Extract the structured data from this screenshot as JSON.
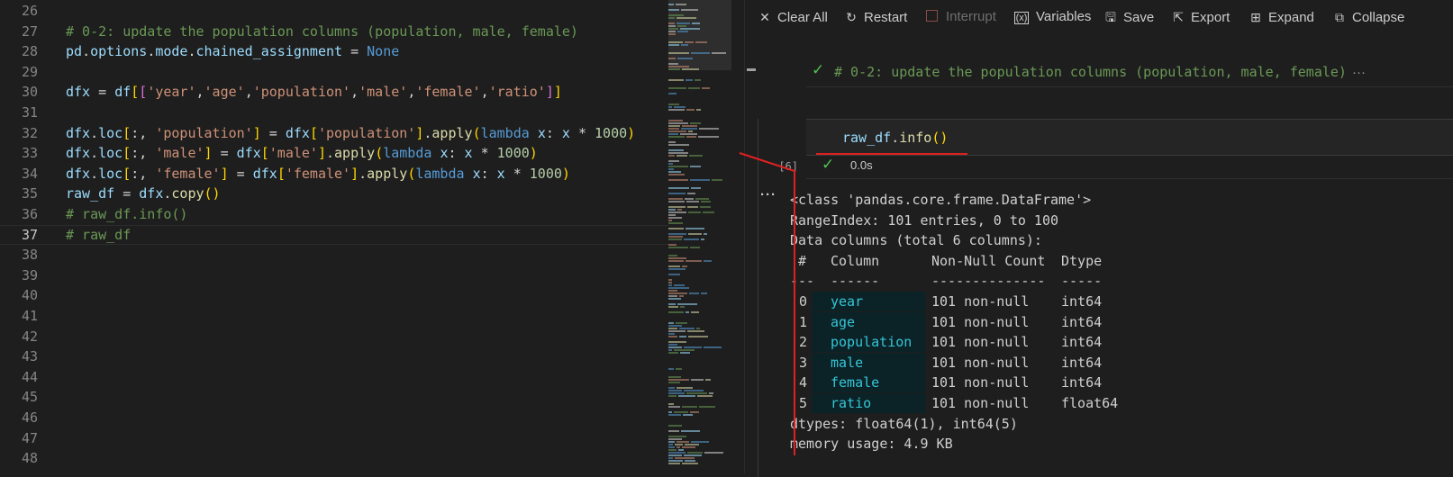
{
  "editor": {
    "lines": [
      {
        "num": "26",
        "tokens": []
      },
      {
        "num": "27",
        "tokens": [
          [
            "cm",
            "# 0-2: update the population columns (population, male, female)"
          ]
        ]
      },
      {
        "num": "28",
        "tokens": [
          [
            "vr",
            "pd"
          ],
          [
            "op",
            "."
          ],
          [
            "vr",
            "options"
          ],
          [
            "op",
            "."
          ],
          [
            "vr",
            "mode"
          ],
          [
            "op",
            "."
          ],
          [
            "vr",
            "chained_assignment"
          ],
          [
            "op",
            " = "
          ],
          [
            "kw",
            "None"
          ]
        ]
      },
      {
        "num": "29",
        "tokens": []
      },
      {
        "num": "30",
        "tokens": [
          [
            "vr",
            "dfx"
          ],
          [
            "op",
            " = "
          ],
          [
            "vr",
            "df"
          ],
          [
            "b1",
            "["
          ],
          [
            "b2",
            "["
          ],
          [
            "st",
            "'year'"
          ],
          [
            "op",
            ","
          ],
          [
            "st",
            "'age'"
          ],
          [
            "op",
            ","
          ],
          [
            "st",
            "'population'"
          ],
          [
            "op",
            ","
          ],
          [
            "st",
            "'male'"
          ],
          [
            "op",
            ","
          ],
          [
            "st",
            "'female'"
          ],
          [
            "op",
            ","
          ],
          [
            "st",
            "'ratio'"
          ],
          [
            "b2",
            "]"
          ],
          [
            "b1",
            "]"
          ]
        ]
      },
      {
        "num": "31",
        "tokens": []
      },
      {
        "num": "32",
        "tokens": [
          [
            "vr",
            "dfx"
          ],
          [
            "op",
            "."
          ],
          [
            "vr",
            "loc"
          ],
          [
            "b1",
            "["
          ],
          [
            "op",
            ":, "
          ],
          [
            "st",
            "'population'"
          ],
          [
            "b1",
            "]"
          ],
          [
            "op",
            " = "
          ],
          [
            "vr",
            "dfx"
          ],
          [
            "b1",
            "["
          ],
          [
            "st",
            "'population'"
          ],
          [
            "b1",
            "]"
          ],
          [
            "op",
            "."
          ],
          [
            "fn",
            "apply"
          ],
          [
            "b1",
            "("
          ],
          [
            "kw",
            "lambda"
          ],
          [
            "op",
            " "
          ],
          [
            "vr",
            "x"
          ],
          [
            "op",
            ": "
          ],
          [
            "vr",
            "x"
          ],
          [
            "op",
            " * "
          ],
          [
            "nm",
            "1000"
          ],
          [
            "b1",
            ")"
          ]
        ]
      },
      {
        "num": "33",
        "tokens": [
          [
            "vr",
            "dfx"
          ],
          [
            "op",
            "."
          ],
          [
            "vr",
            "loc"
          ],
          [
            "b1",
            "["
          ],
          [
            "op",
            ":, "
          ],
          [
            "st",
            "'male'"
          ],
          [
            "b1",
            "]"
          ],
          [
            "op",
            " = "
          ],
          [
            "vr",
            "dfx"
          ],
          [
            "b1",
            "["
          ],
          [
            "st",
            "'male'"
          ],
          [
            "b1",
            "]"
          ],
          [
            "op",
            "."
          ],
          [
            "fn",
            "apply"
          ],
          [
            "b1",
            "("
          ],
          [
            "kw",
            "lambda"
          ],
          [
            "op",
            " "
          ],
          [
            "vr",
            "x"
          ],
          [
            "op",
            ": "
          ],
          [
            "vr",
            "x"
          ],
          [
            "op",
            " * "
          ],
          [
            "nm",
            "1000"
          ],
          [
            "b1",
            ")"
          ]
        ]
      },
      {
        "num": "34",
        "tokens": [
          [
            "vr",
            "dfx"
          ],
          [
            "op",
            "."
          ],
          [
            "vr",
            "loc"
          ],
          [
            "b1",
            "["
          ],
          [
            "op",
            ":, "
          ],
          [
            "st",
            "'female'"
          ],
          [
            "b1",
            "]"
          ],
          [
            "op",
            " = "
          ],
          [
            "vr",
            "dfx"
          ],
          [
            "b1",
            "["
          ],
          [
            "st",
            "'female'"
          ],
          [
            "b1",
            "]"
          ],
          [
            "op",
            "."
          ],
          [
            "fn",
            "apply"
          ],
          [
            "b1",
            "("
          ],
          [
            "kw",
            "lambda"
          ],
          [
            "op",
            " "
          ],
          [
            "vr",
            "x"
          ],
          [
            "op",
            ": "
          ],
          [
            "vr",
            "x"
          ],
          [
            "op",
            " * "
          ],
          [
            "nm",
            "1000"
          ],
          [
            "b1",
            ")"
          ]
        ]
      },
      {
        "num": "35",
        "tokens": [
          [
            "vr",
            "raw_df"
          ],
          [
            "op",
            " = "
          ],
          [
            "vr",
            "dfx"
          ],
          [
            "op",
            "."
          ],
          [
            "fn",
            "copy"
          ],
          [
            "b1",
            "()"
          ]
        ]
      },
      {
        "num": "36",
        "tokens": [
          [
            "cm",
            "# raw_df.info()"
          ]
        ]
      },
      {
        "num": "37",
        "tokens": [
          [
            "cm",
            "# raw_df"
          ]
        ],
        "active": true
      },
      {
        "num": "38",
        "tokens": []
      },
      {
        "num": "39",
        "tokens": []
      },
      {
        "num": "40",
        "tokens": []
      },
      {
        "num": "41",
        "tokens": []
      },
      {
        "num": "42",
        "tokens": []
      },
      {
        "num": "43",
        "tokens": []
      },
      {
        "num": "44",
        "tokens": []
      },
      {
        "num": "45",
        "tokens": []
      },
      {
        "num": "46",
        "tokens": []
      },
      {
        "num": "47",
        "tokens": []
      },
      {
        "num": "48",
        "tokens": []
      }
    ]
  },
  "toolbar": {
    "clear_all": {
      "label": "Clear All",
      "icon": "close-icon"
    },
    "restart": {
      "label": "Restart",
      "icon": "restart-icon"
    },
    "interrupt": {
      "label": "Interrupt",
      "icon": "interrupt-icon"
    },
    "variables": {
      "label": "Variables",
      "icon": "variables-icon"
    },
    "save": {
      "label": "Save",
      "icon": "save-icon"
    },
    "export": {
      "label": "Export",
      "icon": "export-icon"
    },
    "expand": {
      "label": "Expand",
      "icon": "expand-icon"
    },
    "collapse": {
      "label": "Collapse",
      "icon": "collapse-icon"
    }
  },
  "prev_cell": {
    "text": "# 0-2: update the population columns (population, male, female)",
    "ellipsis": "···"
  },
  "cell": {
    "code_var": "raw_df",
    "code_dot": ".",
    "code_fn": "info",
    "code_parens": "()",
    "exec_count": "[6]",
    "time": "0.0s"
  },
  "output": {
    "dots": "···",
    "header": [
      "<class 'pandas.core.frame.DataFrame'>",
      "RangeIndex: 101 entries, 0 to 100",
      "Data columns (total 6 columns):"
    ],
    "col_header": {
      "idx": " #",
      "name": "Column",
      "count": "Non-Null Count",
      "dtype": "Dtype"
    },
    "col_rule": {
      "idx": "---",
      "name": "------",
      "count": "--------------",
      "dtype": "-----"
    },
    "rows": [
      {
        "idx": "0",
        "name": "year",
        "count": "101 non-null",
        "dtype": "int64"
      },
      {
        "idx": "1",
        "name": "age",
        "count": "101 non-null",
        "dtype": "int64"
      },
      {
        "idx": "2",
        "name": "population",
        "count": "101 non-null",
        "dtype": "int64"
      },
      {
        "idx": "3",
        "name": "male",
        "count": "101 non-null",
        "dtype": "int64"
      },
      {
        "idx": "4",
        "name": "female",
        "count": "101 non-null",
        "dtype": "int64"
      },
      {
        "idx": "5",
        "name": "ratio",
        "count": "101 non-null",
        "dtype": "float64"
      }
    ],
    "footer": [
      "dtypes: float64(1), int64(5)",
      "memory usage: 4.9 KB"
    ]
  },
  "colors": {
    "annotation": "#e02020",
    "success": "#4ec24e",
    "column_name": "#34c6d6"
  }
}
